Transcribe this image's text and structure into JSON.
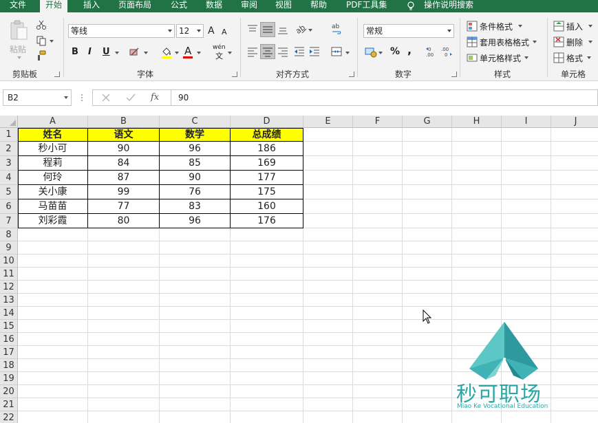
{
  "menu": {
    "tabs": [
      "文件",
      "开始",
      "插入",
      "页面布局",
      "公式",
      "数据",
      "审阅",
      "视图",
      "帮助",
      "PDF工具集"
    ],
    "active": "开始",
    "tell_me": "操作说明搜索"
  },
  "ribbon": {
    "clipboard": {
      "label": "剪贴板",
      "paste": "粘贴"
    },
    "font": {
      "label": "字体",
      "font_name": "等线",
      "font_size": "12",
      "grow": "A",
      "shrink": "A",
      "bold": "B",
      "italic": "I",
      "underline": "U",
      "color_A": "A",
      "phonetic": "wén",
      "phonetic_char": "文"
    },
    "alignment": {
      "label": "对齐方式"
    },
    "number": {
      "label": "数字",
      "format": "常规",
      "percent": "%",
      "comma": ","
    },
    "styles": {
      "label": "样式",
      "conditional": "条件格式",
      "table": "套用表格格式",
      "cell_style": "单元格样式"
    },
    "cells": {
      "label": "单元格",
      "insert": "插入",
      "delete": "删除",
      "format": "格式"
    },
    "colors": {
      "accent": "#217346",
      "ribbon_bg": "#f3f3f3",
      "header_fill": "#ffff00"
    }
  },
  "formula_bar": {
    "name_box": "B2",
    "value": "90",
    "fx": "fx"
  },
  "sheet": {
    "columns": [
      "A",
      "B",
      "C",
      "D",
      "E",
      "F",
      "G",
      "H",
      "I",
      "J"
    ],
    "rows": [
      "1",
      "2",
      "3",
      "4",
      "5",
      "6",
      "7",
      "8",
      "9",
      "10",
      "11",
      "12",
      "13",
      "14",
      "15",
      "16",
      "17",
      "18",
      "19",
      "20",
      "21",
      "22"
    ],
    "header": [
      "姓名",
      "语文",
      "数学",
      "总成绩"
    ],
    "data": [
      [
        "秒小可",
        "90",
        "96",
        "186"
      ],
      [
        "程莉",
        "84",
        "85",
        "169"
      ],
      [
        "何玲",
        "87",
        "90",
        "177"
      ],
      [
        "关小康",
        "99",
        "76",
        "175"
      ],
      [
        "马苗苗",
        "77",
        "83",
        "160"
      ],
      [
        "刘彩霞",
        "80",
        "96",
        "176"
      ]
    ]
  },
  "watermark": {
    "title": "秒可职场",
    "subtitle": "Miao Ke Vocational Education"
  }
}
